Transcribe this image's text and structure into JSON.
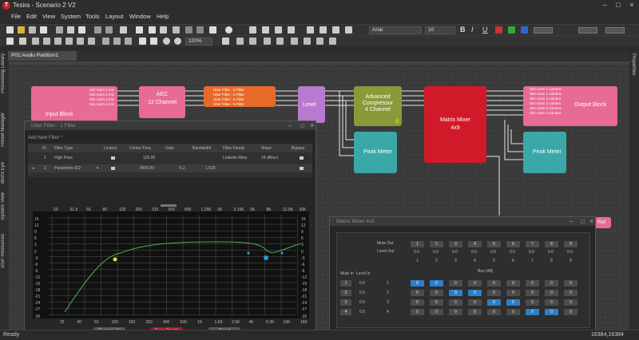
{
  "app": {
    "title": "Tesira - Scenario 2 V2"
  },
  "menu": [
    "File",
    "Edit",
    "View",
    "System",
    "Tools",
    "Layout",
    "Window",
    "Help"
  ],
  "toolbar": {
    "font": "Arial",
    "size": "10",
    "zoom": "100%"
  },
  "tab": {
    "label": "P01:Audio Partition1"
  },
  "side_left": [
    "Processing Library",
    "Preset Manager",
    "Bird's Eye",
    "System View",
    "DSP Resources"
  ],
  "side_right": [
    "Properties"
  ],
  "blocks": {
    "input": {
      "name": "Input Block",
      "pins": [
        "Sim room 1 mic",
        "Sim room 2 mic",
        "Sim room 3 mic",
        "Sim room 4 mic"
      ]
    },
    "aec": {
      "name": "AEC\n12 Channel"
    },
    "uber": {
      "pins": [
        "Uber Filter - 6 Filter",
        "Uber Filter - 6 Filter",
        "Uber Filter - 6 Filter"
      ],
      "name": "Uber Filter - 6 Filter"
    },
    "level": {
      "name": "Level"
    },
    "comp": {
      "name": "Advanced Compressor\n4 Channel",
      "g": "G"
    },
    "mixer": {
      "name": "Matrix Mixer\n4x9"
    },
    "output": {
      "name": "Output Block",
      "pins": [
        "Sim room 1 camera",
        "Sim room 1 camera",
        "Sim room 2 camera",
        "Sim room 3 camera",
        "Sim room 4 camera",
        "Sim room 4 camera"
      ]
    },
    "meter1": {
      "name": "Peak Meter"
    },
    "meter2": {
      "name": "Peak Meter"
    },
    "ref": {
      "name": "Ref"
    }
  },
  "filter_dlg": {
    "title": "Uber Filter - 1 Filter",
    "add_label": "Add New Filter",
    "headers": [
      "ID",
      "Filter Type",
      "Locked",
      "Center Freq",
      "Gain",
      "Bandwidth",
      "Filter Family",
      "Slope",
      "Bypass"
    ],
    "rows": [
      {
        "id": "1",
        "type": "High Pass",
        "freq": "120.00",
        "gain": "",
        "bw": "",
        "family": "Linkwitz-Riley",
        "slope": "24 dB/oct"
      },
      {
        "id": "2",
        "type": "Parametric EQ",
        "freq": "9500.00",
        "gain": "-5.2",
        "bw": "1.529",
        "family": "",
        "slope": ""
      }
    ],
    "freq_top": [
      "20",
      "31.5",
      "50",
      "80",
      "125",
      "200",
      "315",
      "500",
      "800",
      "1.25K",
      "2K",
      "3.15K",
      "5K",
      "8K",
      "12.5K",
      "20K"
    ],
    "freq_bottom": [
      "25",
      "40",
      "63",
      "100",
      "160",
      "250",
      "400",
      "630",
      "1K",
      "1.6K",
      "2.5K",
      "4K",
      "6.3K",
      "10K",
      "16K"
    ],
    "db_ticks": [
      "15",
      "12",
      "9",
      "6",
      "3",
      "0",
      "-3",
      "-6",
      "-9",
      "-12",
      "-15",
      "-18",
      "-21",
      "-24",
      "-27",
      "-30"
    ],
    "buttons": [
      "Bypass All",
      "Drag Points",
      "Band"
    ]
  },
  "mixer_dlg": {
    "title": "Matrix Mixer 4x9",
    "mute_out": "Mute Out",
    "level_out": "Level Out",
    "out_nums": [
      "1",
      "2",
      "3",
      "4",
      "5",
      "6",
      "7",
      "8",
      "9"
    ],
    "level_vals": [
      "0.0",
      "0.0",
      "0.0",
      "0.0",
      "0.0",
      "0.0",
      "0.0",
      "0.0",
      "0.0"
    ],
    "bus_label": "Bus (dB)",
    "mute_in": "Mute In",
    "level_in": "Level In",
    "rows": [
      {
        "n": "1",
        "lvl": "0.0",
        "cells": [
          "0",
          "0",
          "0",
          "0",
          "0",
          "0",
          "0",
          "0",
          "0"
        ],
        "on": [
          0,
          1
        ]
      },
      {
        "n": "2",
        "lvl": "0.0",
        "cells": [
          "0",
          "0",
          "0",
          "0",
          "0",
          "0",
          "0",
          "0",
          "0"
        ],
        "on": [
          2,
          3
        ]
      },
      {
        "n": "3",
        "lvl": "0.0",
        "cells": [
          "0",
          "0",
          "0",
          "0",
          "0",
          "0",
          "0",
          "0",
          "0"
        ],
        "on": [
          4,
          5
        ]
      },
      {
        "n": "4",
        "lvl": "0.0",
        "cells": [
          "0",
          "0",
          "0",
          "0",
          "0",
          "0",
          "0",
          "0",
          "0"
        ],
        "on": [
          6,
          7
        ]
      }
    ]
  },
  "status": {
    "left": "Ready",
    "right": "16384,16384"
  }
}
